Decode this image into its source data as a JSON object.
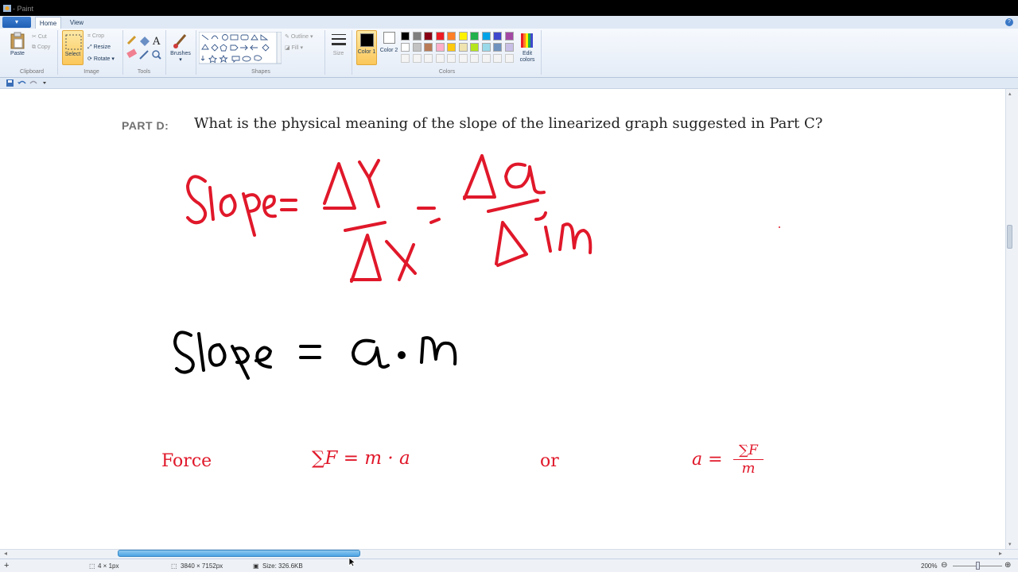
{
  "window": {
    "title": "- Paint"
  },
  "ribbon": {
    "file_button": "▾",
    "tabs": [
      "Home",
      "View"
    ],
    "clipboard": {
      "paste": "Paste",
      "cut": "Cut",
      "copy": "Copy",
      "label": "Clipboard"
    },
    "image": {
      "select": "Select",
      "crop": "Crop",
      "resize": "Resize",
      "rotate": "Rotate",
      "label": "Image"
    },
    "tools": {
      "label": "Tools"
    },
    "brushes": {
      "label": "Brushes"
    },
    "shapes": {
      "outline": "Outline",
      "fill": "Fill",
      "label": "Shapes"
    },
    "size": {
      "label": "Size"
    },
    "colors": {
      "color1": "Color 1",
      "color2": "Color 2",
      "edit": "Edit colors",
      "label": "Colors",
      "palette_row1": [
        "#000000",
        "#7f7f7f",
        "#880015",
        "#ed1c24",
        "#ff7f27",
        "#fff200",
        "#22b14c",
        "#00a2e8",
        "#3f48cc",
        "#a349a4"
      ],
      "palette_row2": [
        "#ffffff",
        "#c3c3c3",
        "#b97a57",
        "#ffaec9",
        "#ffc90e",
        "#efe4b0",
        "#b5e61d",
        "#99d9ea",
        "#7092be",
        "#c8bfe7"
      ],
      "color1_value": "#000000",
      "color2_value": "#ffffff"
    }
  },
  "canvas": {
    "part_label": "PART D:",
    "question": "What is the physical meaning of the slope of the linearized graph suggested in Part C?",
    "force_label": "Force",
    "equation1": "∑F = m · a",
    "or_label": "or",
    "equation2_lhs": "a =",
    "equation2_num": "∑F",
    "equation2_den": "m",
    "ink_color_red": "#e0182a",
    "ink_color_black": "#000000"
  },
  "status": {
    "cursor": "4 × 1px",
    "dimensions": "3840 × 7152px",
    "size": "Size: 326.6KB",
    "zoom": "200%"
  }
}
